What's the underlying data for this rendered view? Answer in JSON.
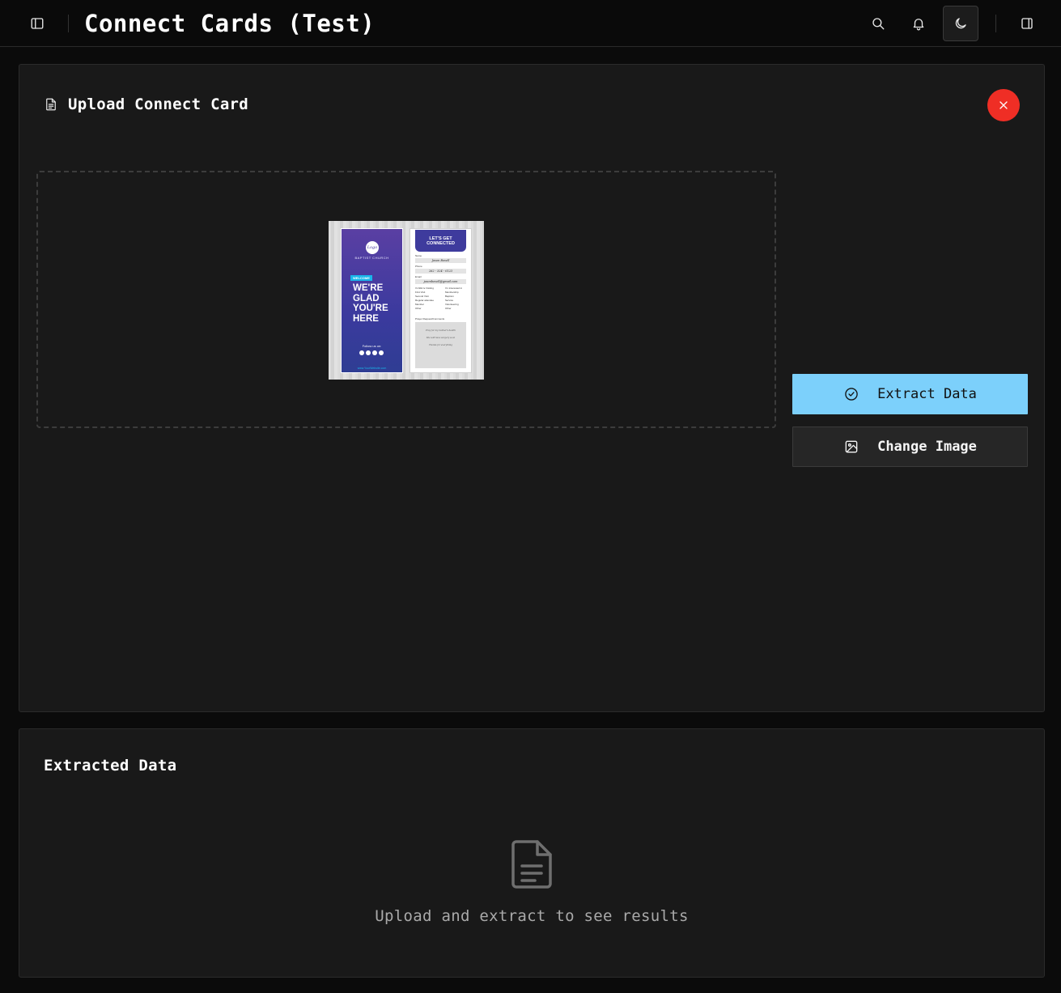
{
  "header": {
    "title": "Connect Cards (Test)",
    "icons": [
      "sidebar-toggle-icon",
      "search-icon",
      "bell-icon",
      "moon-icon",
      "panel-right-icon"
    ]
  },
  "upload_card": {
    "title": "Upload Connect Card",
    "close_icon": "x-icon",
    "preview": {
      "left_panel": {
        "logo": "Logo",
        "church": "BAPTIST CHURCH",
        "tag": "WELCOME",
        "headline": [
          "WE'RE",
          "GLAD",
          "YOU'RE",
          "HERE"
        ],
        "follow": "Follow us on:",
        "site": "www.YourWebsite.com"
      },
      "right_panel": {
        "heading": [
          "LET'S GET",
          "CONNECTED"
        ],
        "name_label": "Name",
        "name_value": "Jason Bovell",
        "phone_label": "Phone",
        "phone_value": "262 - 324 - 0123",
        "email_label": "Email",
        "email_value": "jasonbovell@gmail.com",
        "left_checks": [
          "I'm/We're Visiting",
          "First Visit",
          "Second Visit",
          "Regular attendee",
          "Member",
          "Other"
        ],
        "right_checks": [
          "I'm interested in",
          "Membership",
          "Baptism",
          "Service",
          "Volunteering",
          "Other"
        ],
        "notes_label": "Prayer Request/Comments",
        "notes_lines": [
          "Pray for my mother's health",
          "She will have surgery soon",
          "Thanks for everything"
        ]
      }
    },
    "extract_label": "Extract Data",
    "change_label": "Change Image",
    "accent": "#7cd0fb",
    "close_color": "#ef2e25"
  },
  "extracted_card": {
    "title": "Extracted Data",
    "empty_icon": "file-text-icon",
    "empty_text": "Upload and extract to see results"
  }
}
